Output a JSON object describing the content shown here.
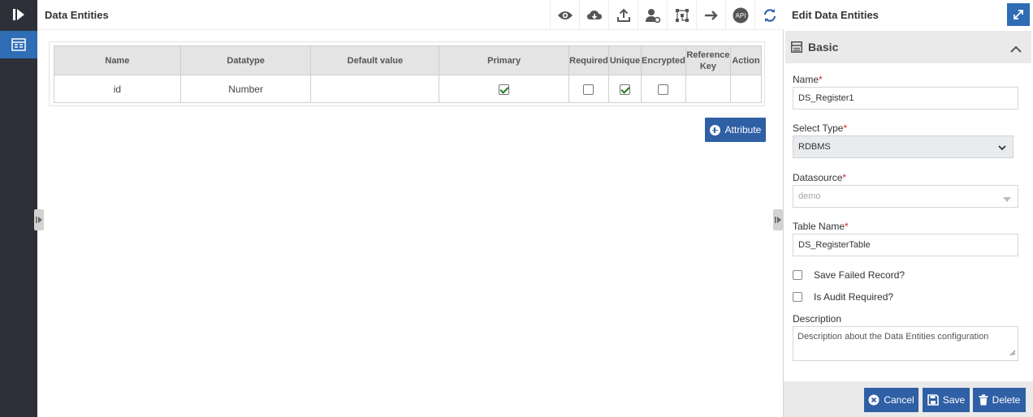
{
  "rail": {
    "logo_icon": "play-bar-icon",
    "active_item_icon": "data-entities-icon"
  },
  "main": {
    "title": "Data Entities",
    "toolbar": [
      "eye-icon",
      "cloud-download-icon",
      "upload-icon",
      "user-settings-icon",
      "flow-icon",
      "arrow-right-icon",
      "api-icon",
      "refresh-icon"
    ],
    "api_label": "API",
    "table": {
      "headers": [
        "Name",
        "Datatype",
        "Default value",
        "Primary",
        "Required",
        "Unique",
        "Encrypted",
        "Reference Key",
        "Action"
      ],
      "rows": [
        {
          "name": "id",
          "datatype": "Number",
          "default_value": "",
          "primary": true,
          "required": false,
          "unique": true,
          "encrypted": false
        }
      ]
    },
    "attribute_button": "Attribute"
  },
  "side": {
    "title": "Edit Data Entities",
    "section": "Basic",
    "name_label": "Name",
    "name_value": "DS_Register1",
    "select_type_label": "Select Type",
    "select_type_value": "RDBMS",
    "datasource_label": "Datasource",
    "datasource_value": "demo",
    "table_name_label": "Table Name",
    "table_name_value": "DS_RegisterTable",
    "save_failed_label": "Save Failed Record?",
    "audit_label": "Is Audit Required?",
    "description_label": "Description",
    "description_value": "Description about the Data Entities configuration",
    "required_mark": "*",
    "buttons": {
      "cancel": "Cancel",
      "save": "Save",
      "delete": "Delete"
    }
  },
  "colors": {
    "accent": "#2f5fa5",
    "rail": "#2d3039",
    "rail_active": "#2f6db5",
    "required": "#d9242b"
  }
}
